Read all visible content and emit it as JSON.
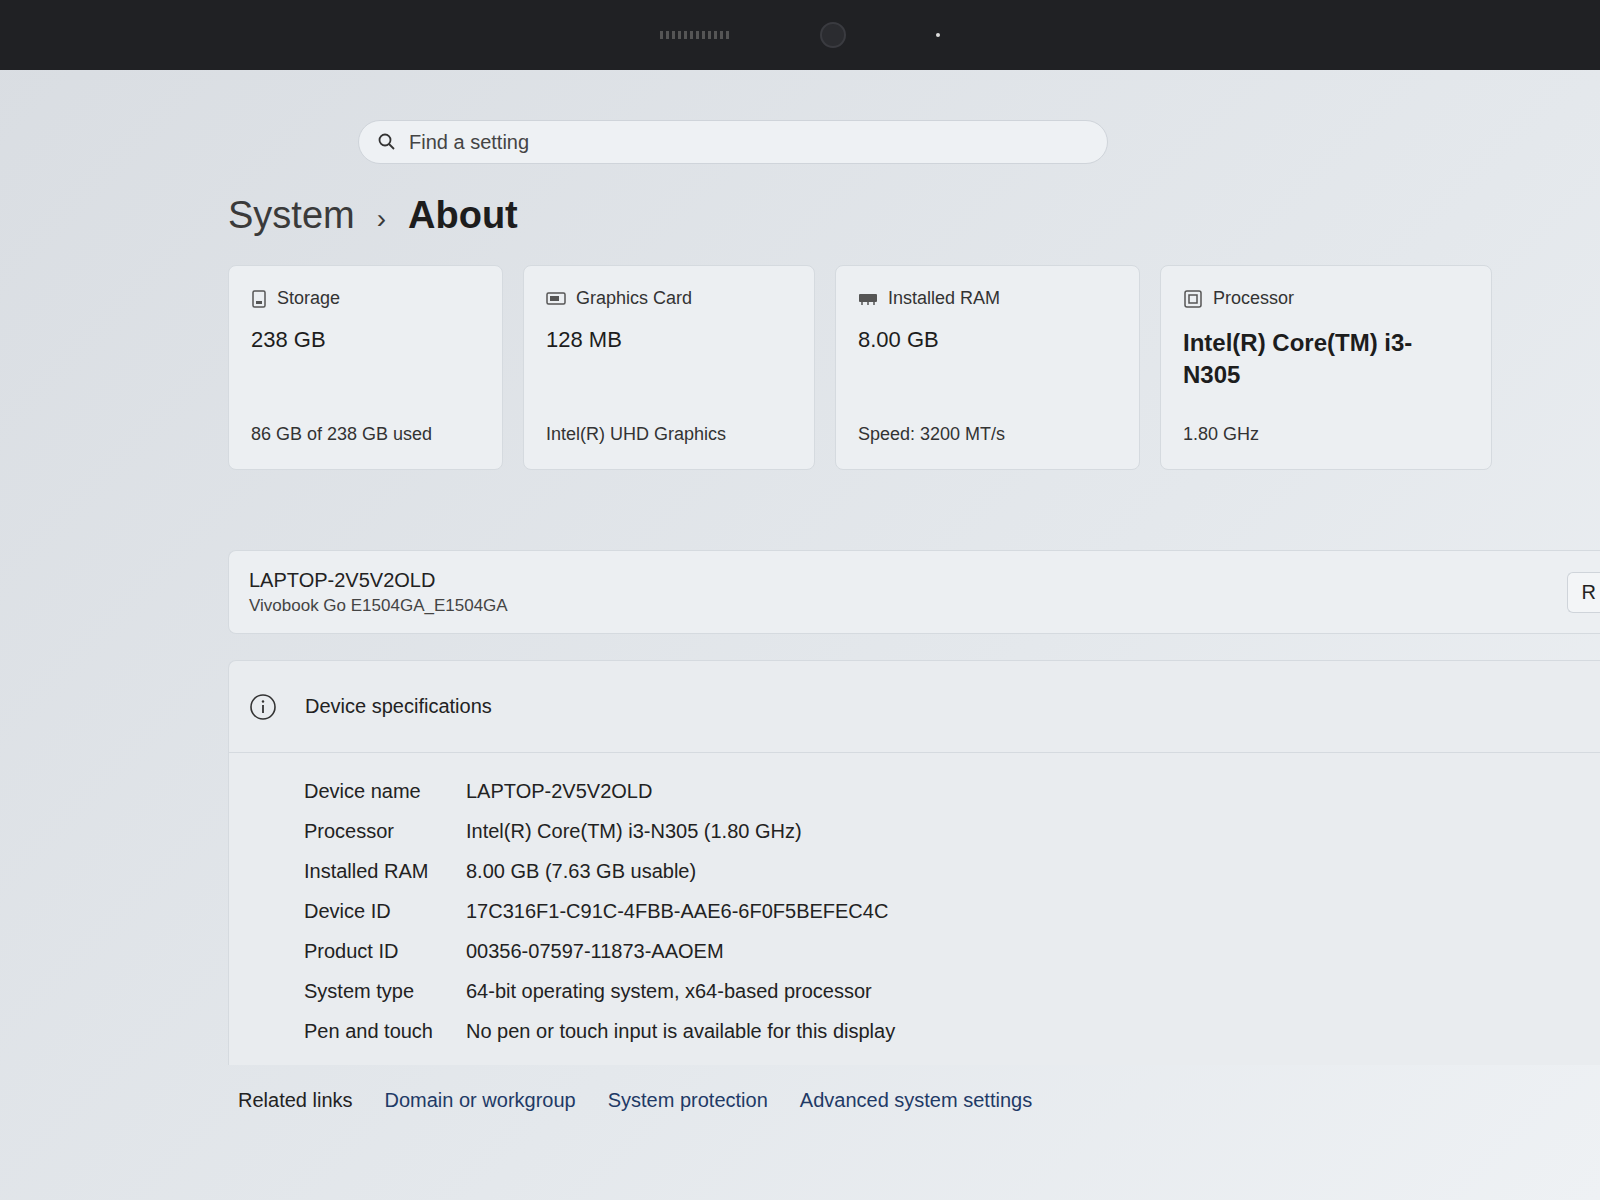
{
  "search": {
    "placeholder": "Find a setting"
  },
  "breadcrumb": {
    "parent": "System",
    "separator": "›",
    "current": "About"
  },
  "cards": [
    {
      "kind": "storage",
      "label": "Storage",
      "value": "238 GB",
      "detail": "86 GB of 238 GB used"
    },
    {
      "kind": "graphics",
      "label": "Graphics Card",
      "value": "128 MB",
      "detail": "Intel(R) UHD Graphics"
    },
    {
      "kind": "ram",
      "label": "Installed RAM",
      "value": "8.00 GB",
      "detail": "Speed: 3200 MT/s"
    },
    {
      "kind": "processor",
      "label": "Processor",
      "value": "Intel(R) Core(TM) i3-N305",
      "detail": "1.80 GHz"
    }
  ],
  "device": {
    "name": "LAPTOP-2V5V2OLD",
    "model": "Vivobook Go E1504GA_E1504GA",
    "action": "R"
  },
  "specifications": {
    "title": "Device specifications",
    "rows": [
      {
        "label": "Device name",
        "value": "LAPTOP-2V5V2OLD"
      },
      {
        "label": "Processor",
        "value": "Intel(R) Core(TM) i3-N305 (1.80 GHz)"
      },
      {
        "label": "Installed RAM",
        "value": "8.00 GB (7.63 GB usable)"
      },
      {
        "label": "Device ID",
        "value": "17C316F1-C91C-4FBB-AAE6-6F0F5BEFEC4C"
      },
      {
        "label": "Product ID",
        "value": "00356-07597-11873-AAOEM"
      },
      {
        "label": "System type",
        "value": "64-bit operating system, x64-based processor"
      },
      {
        "label": "Pen and touch",
        "value": "No pen or touch input is available for this display"
      }
    ]
  },
  "related_links": {
    "title": "Related links",
    "links": [
      "Domain or workgroup",
      "System protection",
      "Advanced system settings"
    ]
  }
}
